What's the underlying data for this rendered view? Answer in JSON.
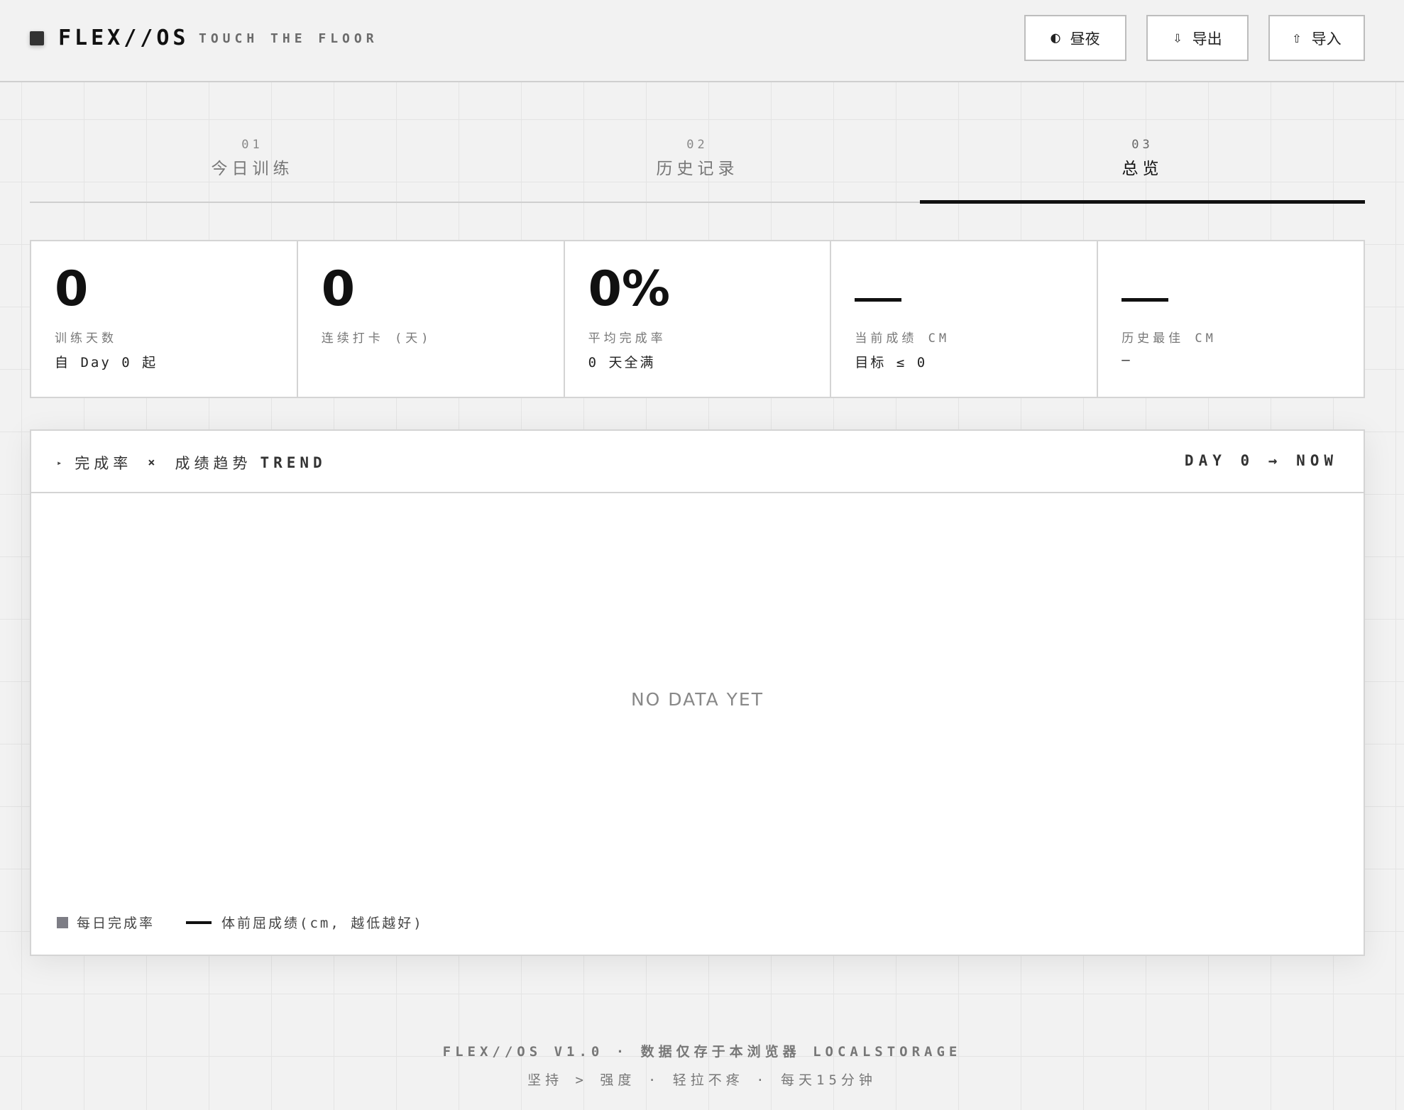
{
  "header": {
    "logo": "FLEX//OS",
    "tagline": "TOUCH THE FLOOR",
    "buttons": {
      "daynight": {
        "icon": "◐",
        "label": "昼夜"
      },
      "export": {
        "icon": "⇩",
        "label": "导出"
      },
      "import": {
        "icon": "⇧",
        "label": "导入"
      }
    }
  },
  "tabs": [
    {
      "num": "01",
      "label": "今日训练",
      "active": false
    },
    {
      "num": "02",
      "label": "历史记录",
      "active": false
    },
    {
      "num": "03",
      "label": "总览",
      "active": true
    }
  ],
  "stats": [
    {
      "value": "0",
      "label": "训练天数",
      "sub": "自 Day 0 起"
    },
    {
      "value": "0",
      "label": "连续打卡 (天)",
      "sub": ""
    },
    {
      "value": "0%",
      "label": "平均完成率",
      "sub": "0 天全满"
    },
    {
      "value": "",
      "label": "当前成绩 CM",
      "sub": "目标 ≤ 0"
    },
    {
      "value": "",
      "label": "历史最佳 CM",
      "sub": "—"
    }
  ],
  "chart": {
    "marker": "▸",
    "title_part1": "完成率",
    "title_sep": "×",
    "title_part2": "成绩趋势",
    "title_en": "TREND",
    "range": "DAY 0 → NOW",
    "empty_text": "NO DATA YET",
    "legend": {
      "bar": "每日完成率",
      "line": "体前屈成绩(cm, 越低越好)"
    }
  },
  "footer": {
    "line1": "FLEX//OS V1.0 · 数据仅存于本浏览器 LOCALSTORAGE",
    "line2": "坚持 > 强度 · 轻拉不疼 · 每天15分钟"
  }
}
